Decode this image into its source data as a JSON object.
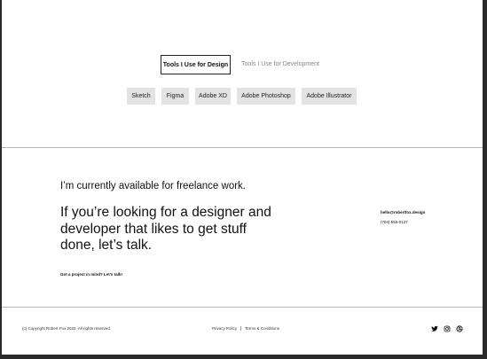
{
  "tools": {
    "tabs": [
      {
        "label": "Tools I Use for Design",
        "active": true
      },
      {
        "label": "Tools I Use for Development",
        "active": false
      }
    ],
    "chips": [
      "Sketch",
      "Figma",
      "Adobe XD",
      "Adobe Photoshop",
      "Adobe Illustrator"
    ]
  },
  "contact": {
    "availability": "I’m currently available for freelance work.",
    "pitch": "If you’re looking for a designer and developer that likes to get stuff done, let’s talk.",
    "cta": "Got a project in mind? Let’s talk!",
    "email": "hello@robertfox.design",
    "phone": "(704) 555-0127"
  },
  "footer": {
    "copyright": "(c) Copyright Robert Fox 2022. All rights reserved.",
    "links": [
      "Privacy Policy",
      "Terms & Conditions"
    ],
    "social_icons": [
      "twitter-icon",
      "instagram-icon",
      "dribbble-icon"
    ]
  },
  "colors": {
    "background": "#ffffff",
    "frame": "#2a2a2a",
    "chip": "#e3e3e3",
    "divider": "#b8b8b8",
    "inactive_text": "#888888"
  }
}
